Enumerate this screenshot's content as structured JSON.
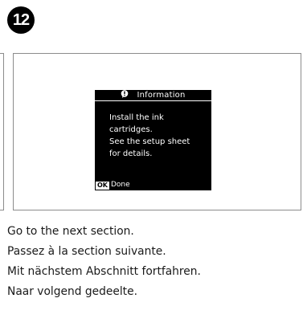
{
  "step": {
    "number": "12"
  },
  "screen": {
    "header": {
      "icon": "info-icon",
      "title": "Information"
    },
    "message_lines": [
      "Install the ink",
      "cartridges.",
      "See the setup sheet",
      "for details."
    ],
    "footer": {
      "button_label": "OK",
      "action_label": "Done"
    }
  },
  "instructions": [
    "Go to the next section.",
    "Passez à la section suivante.",
    "Mit nächstem Abschnitt fortfahren.",
    "Naar volgend gedeelte."
  ],
  "colors": {
    "screen_background": "#000000",
    "screen_text": "#ffffff",
    "frame_border": "#8c8c8c"
  }
}
